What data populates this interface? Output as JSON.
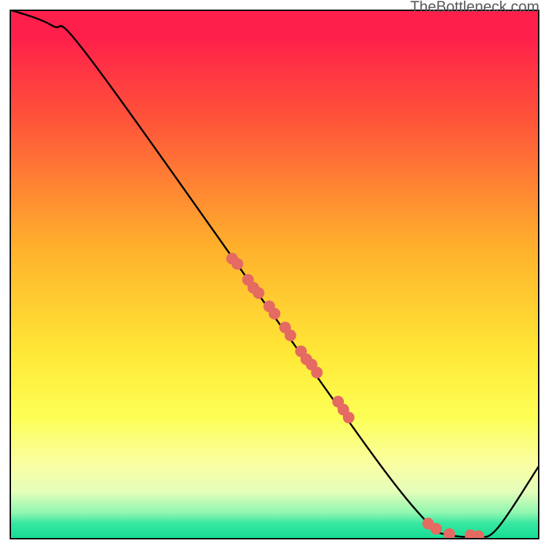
{
  "attribution": "TheBottleneck.com",
  "chart_data": {
    "type": "line",
    "title": "",
    "xlabel": "",
    "ylabel": "",
    "xlim": [
      0,
      100
    ],
    "ylim": [
      0,
      100
    ],
    "curve": [
      {
        "x": 0,
        "y": 100
      },
      {
        "x": 8,
        "y": 97
      },
      {
        "x": 15,
        "y": 91
      },
      {
        "x": 50,
        "y": 42
      },
      {
        "x": 70,
        "y": 14
      },
      {
        "x": 79,
        "y": 3
      },
      {
        "x": 82,
        "y": 1
      },
      {
        "x": 88,
        "y": 0.5
      },
      {
        "x": 92,
        "y": 2
      },
      {
        "x": 100,
        "y": 14
      }
    ],
    "scatter": [
      {
        "x": 42,
        "y": 53
      },
      {
        "x": 43,
        "y": 52
      },
      {
        "x": 45,
        "y": 49
      },
      {
        "x": 46,
        "y": 47.5
      },
      {
        "x": 47,
        "y": 46.5
      },
      {
        "x": 49,
        "y": 44
      },
      {
        "x": 50,
        "y": 42.6
      },
      {
        "x": 52,
        "y": 40
      },
      {
        "x": 53,
        "y": 38.5
      },
      {
        "x": 55,
        "y": 35.5
      },
      {
        "x": 56,
        "y": 34
      },
      {
        "x": 57,
        "y": 33
      },
      {
        "x": 58,
        "y": 31.5
      },
      {
        "x": 62,
        "y": 26
      },
      {
        "x": 63,
        "y": 24.5
      },
      {
        "x": 64,
        "y": 23
      },
      {
        "x": 79,
        "y": 3
      },
      {
        "x": 80.5,
        "y": 2
      },
      {
        "x": 83,
        "y": 1
      },
      {
        "x": 87,
        "y": 0.8
      },
      {
        "x": 88.5,
        "y": 0.6
      }
    ],
    "gradient_stops": [
      {
        "p": 0.0,
        "c": "#ff1f4b"
      },
      {
        "p": 0.05,
        "c": "#ff1f4b"
      },
      {
        "p": 0.2,
        "c": "#ff513a"
      },
      {
        "p": 0.45,
        "c": "#ffb12c"
      },
      {
        "p": 0.65,
        "c": "#ffe836"
      },
      {
        "p": 0.77,
        "c": "#fdff55"
      },
      {
        "p": 0.81,
        "c": "#fbff7a"
      },
      {
        "p": 0.86,
        "c": "#fafea4"
      },
      {
        "p": 0.91,
        "c": "#e4feba"
      },
      {
        "p": 0.95,
        "c": "#8ef6b0"
      },
      {
        "p": 0.97,
        "c": "#37e7a1"
      },
      {
        "p": 1.0,
        "c": "#13dd94"
      }
    ],
    "point_color": "#e46a62",
    "curve_color": "#000000"
  }
}
